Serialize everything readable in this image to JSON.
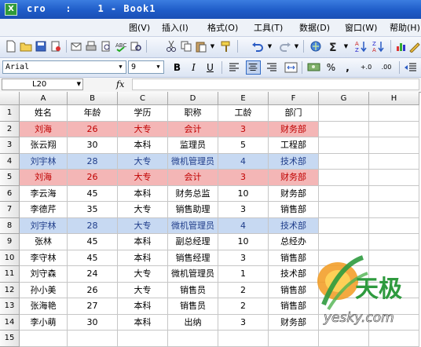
{
  "window": {
    "title": "cro   :    1 - Book1",
    "app_icon_glyph": "X"
  },
  "menu": [
    "图(V)",
    "插入(I)",
    "格式(O)",
    "工具(T)",
    "数据(D)",
    "窗口(W)",
    "帮助(H)"
  ],
  "format_toolbar": {
    "font_name": "Arial",
    "font_size": "9",
    "bold": "B",
    "italic": "I",
    "underline": "U",
    "percent": "%",
    "comma": ",",
    "inc_decimal": "+.0",
    "dec_decimal": ".00"
  },
  "formula_bar": {
    "name_box": "L20",
    "fx": "fx",
    "formula": ""
  },
  "columns": [
    "A",
    "B",
    "C",
    "D",
    "E",
    "F",
    "G",
    "H"
  ],
  "rows": [
    {
      "num": "1",
      "cells": [
        "姓名",
        "年龄",
        "学历",
        "职称",
        "工龄",
        "部门"
      ],
      "highlight": "none"
    },
    {
      "num": "2",
      "cells": [
        "刘海",
        "26",
        "大专",
        "会计",
        "3",
        "财务部"
      ],
      "highlight": "red"
    },
    {
      "num": "3",
      "cells": [
        "张云翔",
        "30",
        "本科",
        "监理员",
        "5",
        "工程部"
      ],
      "highlight": "none"
    },
    {
      "num": "4",
      "cells": [
        "刘宇林",
        "28",
        "大专",
        "微机管理员",
        "4",
        "技术部"
      ],
      "highlight": "blue"
    },
    {
      "num": "5",
      "cells": [
        "刘海",
        "26",
        "大专",
        "会计",
        "3",
        "财务部"
      ],
      "highlight": "red"
    },
    {
      "num": "6",
      "cells": [
        "李云海",
        "45",
        "本科",
        "财务总监",
        "10",
        "财务部"
      ],
      "highlight": "none"
    },
    {
      "num": "7",
      "cells": [
        "李德芹",
        "35",
        "大专",
        "销售助理",
        "3",
        "销售部"
      ],
      "highlight": "none"
    },
    {
      "num": "8",
      "cells": [
        "刘宇林",
        "28",
        "大专",
        "微机管理员",
        "4",
        "技术部"
      ],
      "highlight": "blue"
    },
    {
      "num": "9",
      "cells": [
        "张林",
        "45",
        "本科",
        "副总经理",
        "10",
        "总经办"
      ],
      "highlight": "none"
    },
    {
      "num": "10",
      "cells": [
        "李守林",
        "45",
        "本科",
        "销售经理",
        "3",
        "销售部"
      ],
      "highlight": "none"
    },
    {
      "num": "11",
      "cells": [
        "刘守森",
        "24",
        "大专",
        "微机管理员",
        "1",
        "技术部"
      ],
      "highlight": "none"
    },
    {
      "num": "12",
      "cells": [
        "孙小美",
        "26",
        "大专",
        "销售员",
        "2",
        "销售部"
      ],
      "highlight": "none"
    },
    {
      "num": "13",
      "cells": [
        "张海艳",
        "27",
        "本科",
        "销售员",
        "2",
        "销售部"
      ],
      "highlight": "none"
    },
    {
      "num": "14",
      "cells": [
        "李小萌",
        "30",
        "本科",
        "出纳",
        "3",
        "财务部"
      ],
      "highlight": "none"
    },
    {
      "num": "15",
      "cells": [
        "",
        "",
        "",
        "",
        "",
        ""
      ],
      "highlight": "none"
    }
  ],
  "colors": {
    "highlight_red": "#f4b6b6",
    "highlight_blue": "#c7d9f2",
    "red_text": "#c00000",
    "blue_text": "#1f3d8a"
  },
  "watermark": {
    "brand": "天极",
    "url": "yesky.com"
  }
}
